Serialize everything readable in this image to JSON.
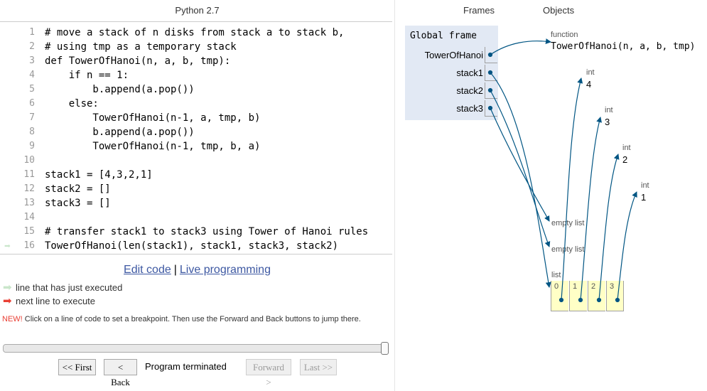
{
  "code_panel": {
    "language": "Python 2.7",
    "lines": [
      {
        "num": "1",
        "text": "# move a stack of n disks from stack a to stack b,"
      },
      {
        "num": "2",
        "text": "# using tmp as a temporary stack"
      },
      {
        "num": "3",
        "text": "def TowerOfHanoi(n, a, b, tmp):"
      },
      {
        "num": "4",
        "text": "    if n == 1:"
      },
      {
        "num": "5",
        "text": "        b.append(a.pop())"
      },
      {
        "num": "6",
        "text": "    else:"
      },
      {
        "num": "7",
        "text": "        TowerOfHanoi(n-1, a, tmp, b)"
      },
      {
        "num": "8",
        "text": "        b.append(a.pop())"
      },
      {
        "num": "9",
        "text": "        TowerOfHanoi(n-1, tmp, b, a)"
      },
      {
        "num": "10",
        "text": ""
      },
      {
        "num": "11",
        "text": "stack1 = [4,3,2,1]"
      },
      {
        "num": "12",
        "text": "stack2 = []"
      },
      {
        "num": "13",
        "text": "stack3 = []"
      },
      {
        "num": "14",
        "text": ""
      },
      {
        "num": "15",
        "text": "# transfer stack1 to stack3 using Tower of Hanoi rules"
      },
      {
        "num": "16",
        "text": "TowerOfHanoi(len(stack1), stack1, stack3, stack2)"
      }
    ],
    "current_line_arrow": "➡"
  },
  "links": {
    "edit_code": "Edit code",
    "separator": "|",
    "live_programming": "Live programming"
  },
  "legend": {
    "just_executed": "line that has just executed",
    "next_line": "next line to execute",
    "colors": {
      "just_executed": "#c9e6ca",
      "next_line": "#e93f34"
    }
  },
  "tip": {
    "new_label": "NEW!",
    "text": " Click on a line of code to set a breakpoint. Then use the Forward and Back buttons to jump there."
  },
  "progress": {
    "fraction": 1.0
  },
  "controls": {
    "first": "<< First",
    "back": "< Back",
    "status": "Program terminated",
    "forward": "Forward >",
    "last": "Last >>"
  },
  "viz": {
    "frames_header": "Frames",
    "objects_header": "Objects",
    "global_frame_title": "Global frame",
    "variables": [
      "TowerOfHanoi",
      "stack1",
      "stack2",
      "stack3"
    ],
    "function_obj": {
      "type": "function",
      "value": "TowerOfHanoi(n, a, b, tmp)"
    },
    "ints": [
      {
        "type": "int",
        "value": "4"
      },
      {
        "type": "int",
        "value": "3"
      },
      {
        "type": "int",
        "value": "2"
      },
      {
        "type": "int",
        "value": "1"
      }
    ],
    "empty_lists": [
      "empty list",
      "empty list"
    ],
    "list_obj": {
      "type": "list",
      "indices": [
        "0",
        "1",
        "2",
        "3"
      ]
    },
    "colors": {
      "frame_bg": "#e2e9f4",
      "list_bg": "#ffffc6",
      "arrow": "#005583"
    }
  }
}
